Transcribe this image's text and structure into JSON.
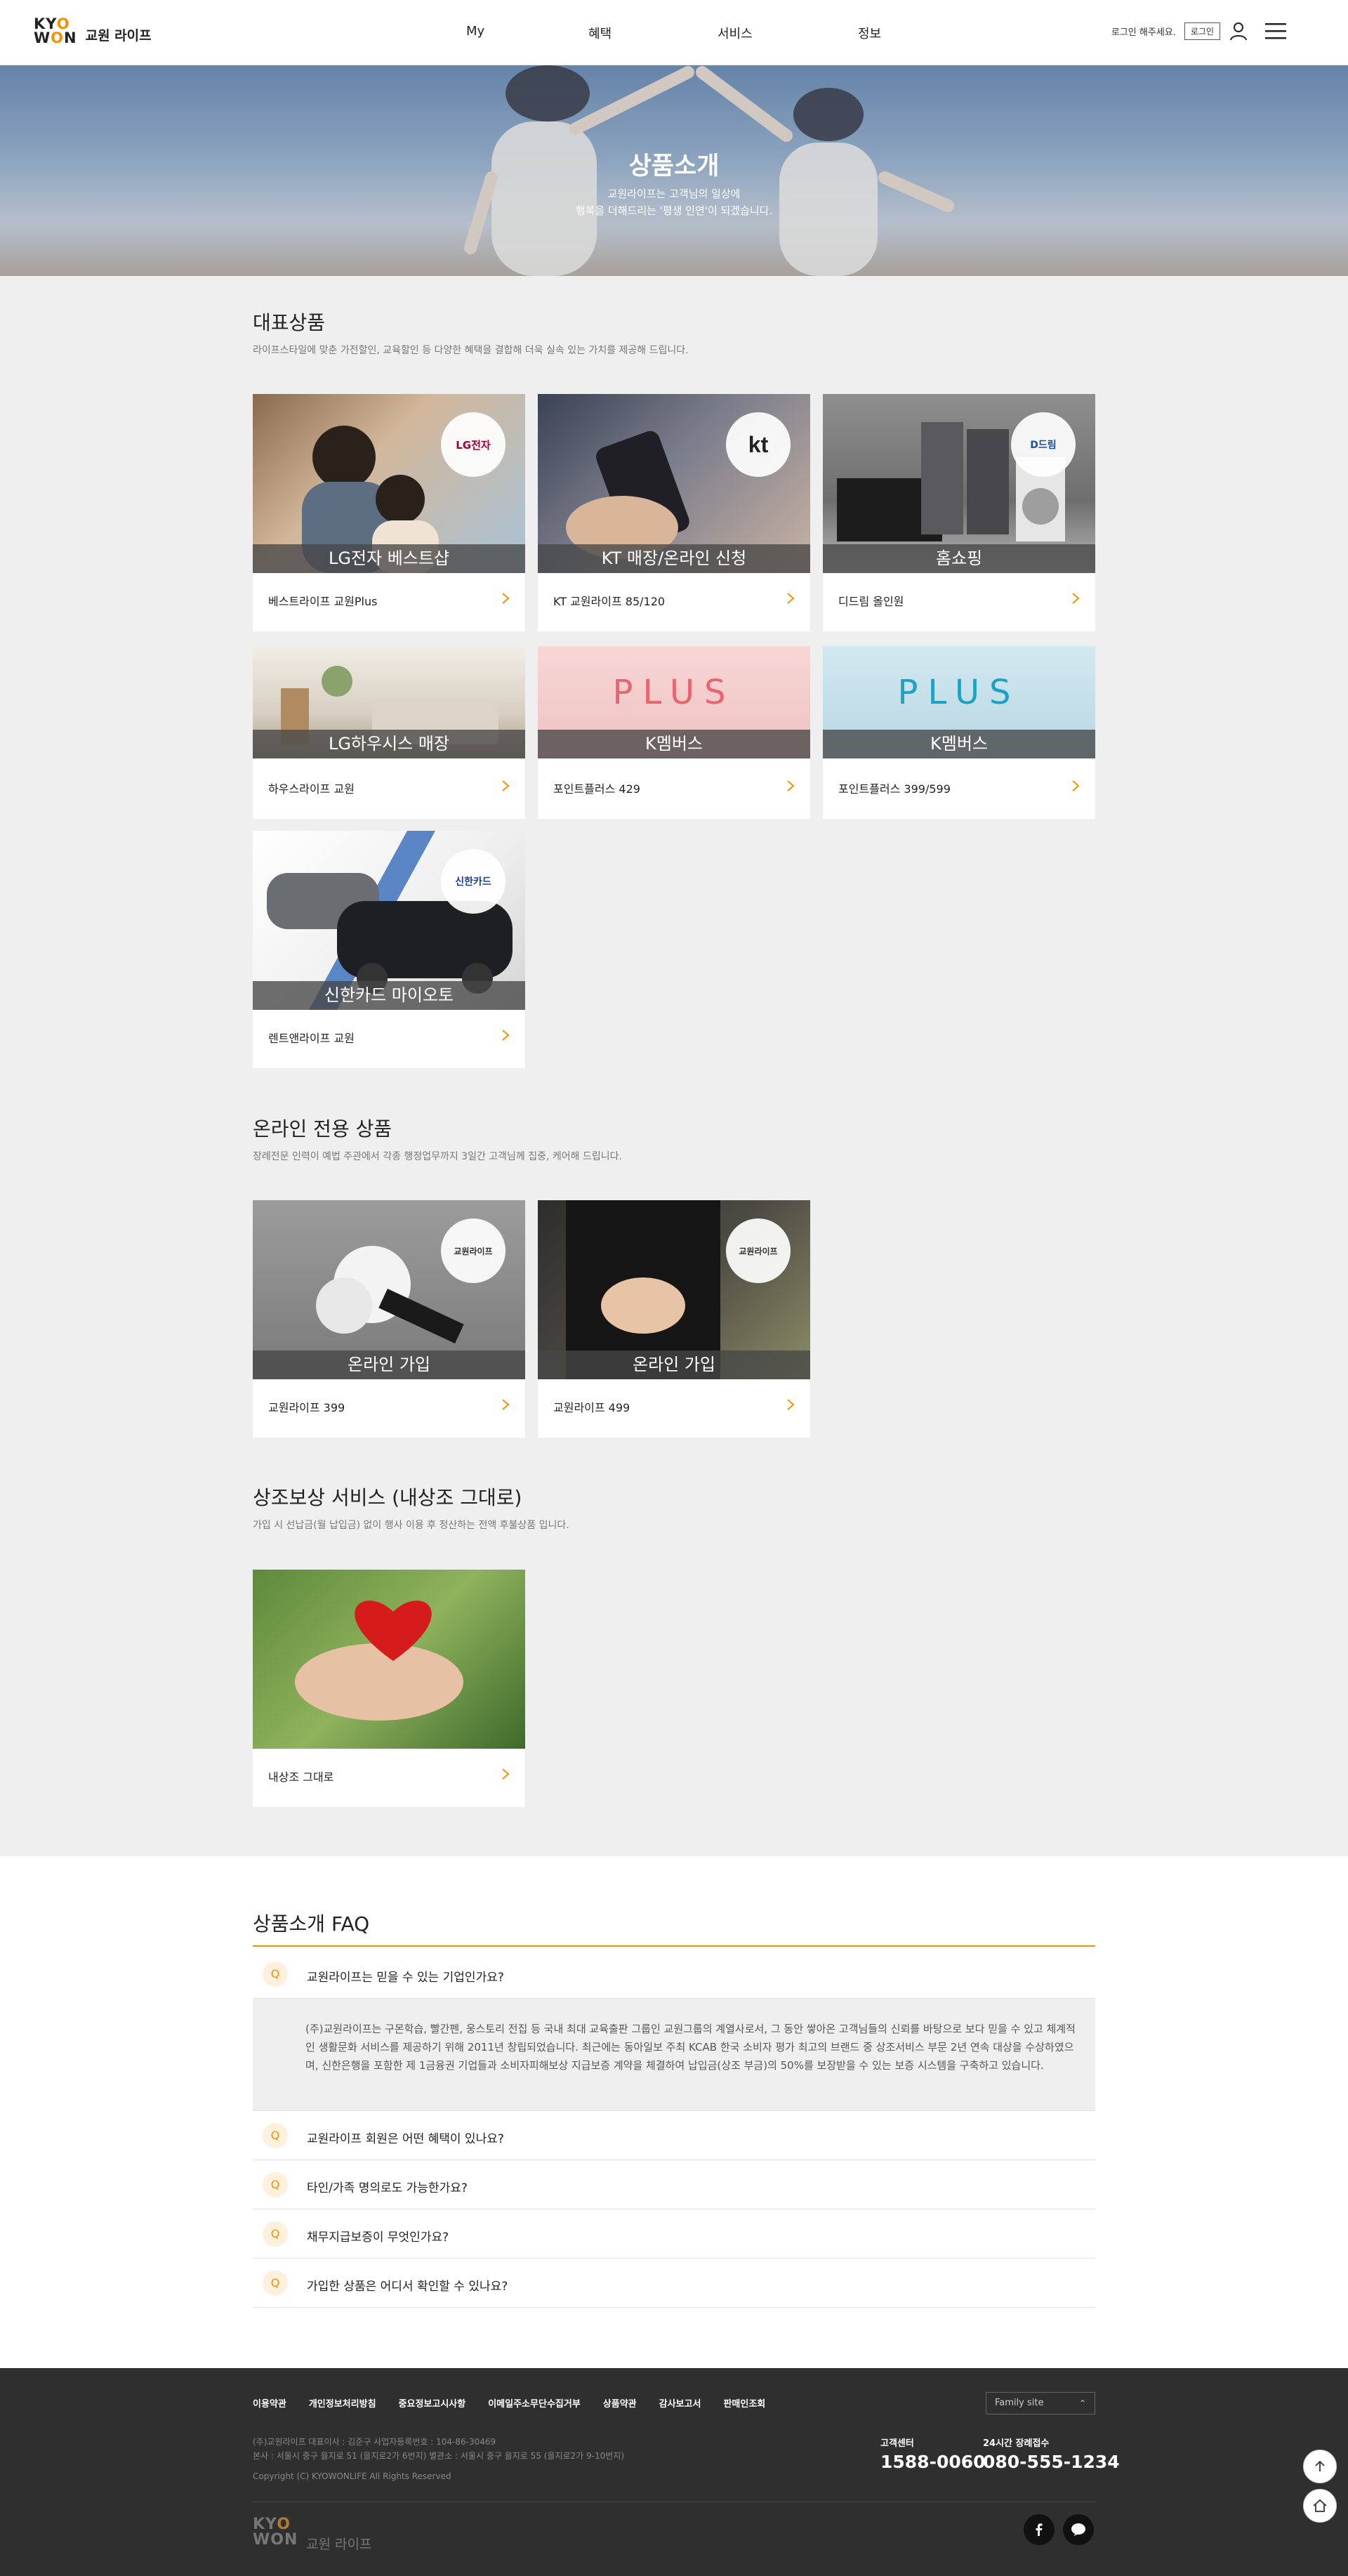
{
  "header": {
    "logo_mark_1a": "KY",
    "logo_mark_1b": "O",
    "logo_mark_2a": "W",
    "logo_mark_2b": "O",
    "logo_mark_2c": "N",
    "logo_text": "교원 라이프",
    "nav": [
      "My",
      "혜택",
      "서비스",
      "정보"
    ],
    "greeting": "로그인 해주세요.",
    "login_label": "로그인"
  },
  "hero": {
    "title": "상품소개",
    "line1": "교원라이프는 고객님의 일상에",
    "line2": "행복을 더해드리는 '평생 인연'이 되겠습니다."
  },
  "sections": {
    "featured": {
      "title": "대표상품",
      "desc": "라이프스타일에 맞춘 가전할인, 교육할인 등 다양한 혜택을 결합해 더욱 실속 있는 가치를 제공해 드립니다.",
      "cards": [
        {
          "caption": "LG전자 베스트샵",
          "name": "베스트라이프 교원Plus",
          "badge": "LG전자"
        },
        {
          "caption": "KT 매장/온라인 신청",
          "name": "KT 교원라이프 85/120",
          "badge": "kt"
        },
        {
          "caption": "홈쇼핑",
          "name": "디드림 올인원",
          "badge": "D드림"
        },
        {
          "caption": "LG하우시스 매장",
          "name": "하우스라이프 교원",
          "badge": ""
        },
        {
          "caption": "K멤버스",
          "name": "포인트플러스 429",
          "badge": "",
          "overlay": "PLUS"
        },
        {
          "caption": "K멤버스",
          "name": "포인트플러스 399/599",
          "badge": "",
          "overlay": "PLUS"
        },
        {
          "caption": "신한카드 마이오토",
          "name": "렌트앤라이프 교원",
          "badge": "신한카드"
        }
      ]
    },
    "online": {
      "title": "온라인 전용 상품",
      "desc": "장례전문 인력이 예법 주관에서 각종 행정업무까지 3일간 고객님께 집중, 케어해 드립니다.",
      "cards": [
        {
          "caption": "온라인 가입",
          "name": "교원라이프 399",
          "badge": "교원라이프"
        },
        {
          "caption": "온라인 가입",
          "name": "교원라이프 499",
          "badge": "교원라이프"
        }
      ]
    },
    "compensation": {
      "title": "상조보상 서비스 (내상조 그대로)",
      "desc": "가입 시 선납금(월 납입금) 없이 행사 이용 후 정산하는 전액 후불상품 입니다.",
      "cards": [
        {
          "caption": "",
          "name": "내상조 그대로",
          "badge": ""
        }
      ]
    }
  },
  "faq": {
    "title": "상품소개 FAQ",
    "q_mark": "Q",
    "items": [
      "교원라이프는 믿을 수 있는 기업인가요?",
      "교원라이프 회원은 어떤 혜택이 있나요?",
      "타인/가족 명의로도 가능한가요?",
      "채무지급보증이 무엇인가요?",
      "가입한 상품은 어디서 확인할 수 있나요?"
    ],
    "answer": "(주)교원라이프는 구몬학습, 빨간펜, 웅스토리 전집 등 국내 최대 교육출판 그룹인 교원그룹의 계열사로서, 그 동안 쌓아온 고객님들의 신뢰를 바탕으로 보다 믿을 수 있고 체계적인 생활문화 서비스를 제공하기 위해 2011년 창립되었습니다. 최근에는 동아일보 주최 KCAB 한국 소비자 평가 최고의 브랜드 중 상조서비스 부문 2년 연속 대상을 수상하였으며, 신한은행을 포함한 제 1금융권 기업들과 소비자피해보상 지급보증 계약을 체결하여 납입금(상조 부금)의 50%를 보장받을 수 있는 보증 시스템을 구축하고 있습니다."
  },
  "footer": {
    "links": [
      "이용약관",
      "개인정보처리방침",
      "중요정보고시사항",
      "이메일주소무단수집거부",
      "상품약관",
      "감사보고서",
      "판매인조회"
    ],
    "family_site": "Family site",
    "info1": "(주)교원라이프 대표이사 : 김준구 사업자등록번호 : 104-86-30469",
    "info2": "본사 : 서울시 중구 을지로 51 (을지로2가 6번지) 별관소 : 서울시 중구 을지로 55 (을지로2가 9-10번지)",
    "copyright": "Copyright (C) KYOWONLIFE All Rights Reserved",
    "cs1_label": "고객센터",
    "cs1_number": "1588-0060",
    "cs2_label": "24시간 장례접수",
    "cs2_number": "080-555-1234",
    "logo_mark_1a": "KY",
    "logo_mark_1b": "O",
    "logo_mark_2": "WON",
    "logo_text": "교원 라이프"
  },
  "icons": {
    "user": "user-icon",
    "menu": "hamburger-icon",
    "arrow": "chevron-right-icon",
    "facebook": "facebook-icon",
    "talk": "chat-bubble-icon",
    "top": "arrow-up-icon",
    "home": "home-icon"
  },
  "colors": {
    "accent": "#f39200",
    "bg_gray": "#efefef",
    "footer": "#2f2f2f"
  }
}
